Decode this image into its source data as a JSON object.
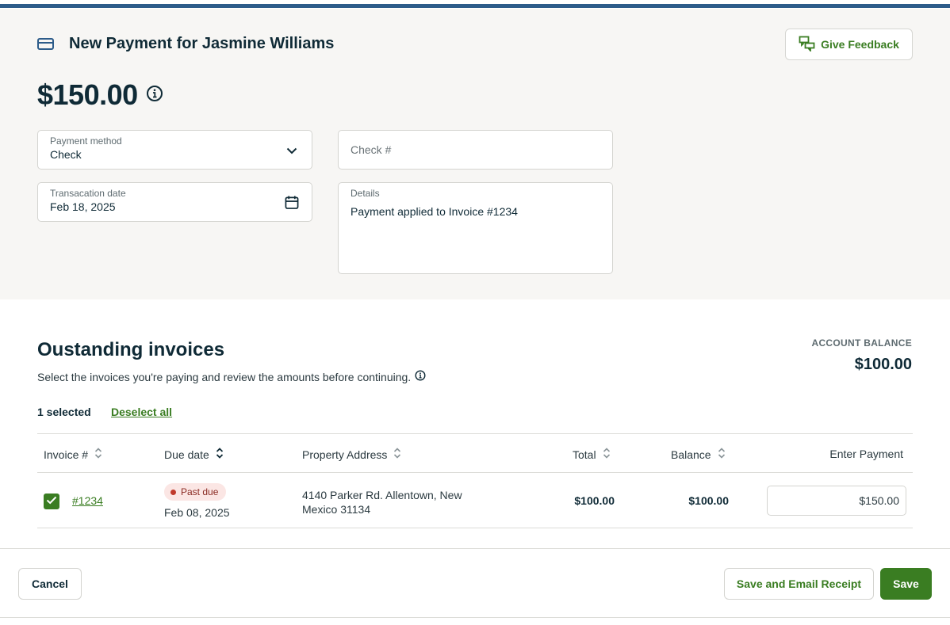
{
  "header": {
    "title": "New Payment for Jasmine Williams",
    "feedback_label": "Give Feedback",
    "amount": "$150.00"
  },
  "form": {
    "payment_method": {
      "label": "Payment method",
      "value": "Check"
    },
    "check_number": {
      "placeholder": "Check #"
    },
    "transaction_date": {
      "label": "Transacation date",
      "value": "Feb 18, 2025"
    },
    "details": {
      "label": "Details",
      "value": "Payment applied to Invoice #1234"
    }
  },
  "invoices": {
    "title": "Oustanding invoices",
    "subtitle": "Select the invoices you're paying and review the amounts before continuing.",
    "account_balance_label": "ACCOUNT BALANCE",
    "account_balance_value": "$100.00",
    "selected_count": "1 selected",
    "deselect_label": "Deselect all",
    "columns": {
      "invoice": "Invoice #",
      "due_date": "Due date",
      "address": "Property Address",
      "total": "Total",
      "balance": "Balance",
      "payment": "Enter Payment"
    },
    "rows": [
      {
        "checked": true,
        "invoice": "#1234",
        "status": "Past due",
        "due_date": "Feb 08, 2025",
        "address": "4140 Parker Rd. Allentown, New Mexico 31134",
        "total": "$100.00",
        "balance": "$100.00",
        "payment": "$150.00"
      }
    ]
  },
  "footer": {
    "cancel_label": "Cancel",
    "save_email_label": "Save and Email Receipt",
    "save_label": "Save"
  },
  "colors": {
    "accent_green": "#3a7d22",
    "top_bar_blue": "#2d5c8a",
    "past_due_bg": "#fbe6e4",
    "past_due_dot": "#c0392b"
  },
  "icons": [
    "credit-card-icon",
    "feedback-chat-icon",
    "info-icon",
    "chevron-down-icon",
    "calendar-icon",
    "sort-icon",
    "checkmark-icon"
  ]
}
